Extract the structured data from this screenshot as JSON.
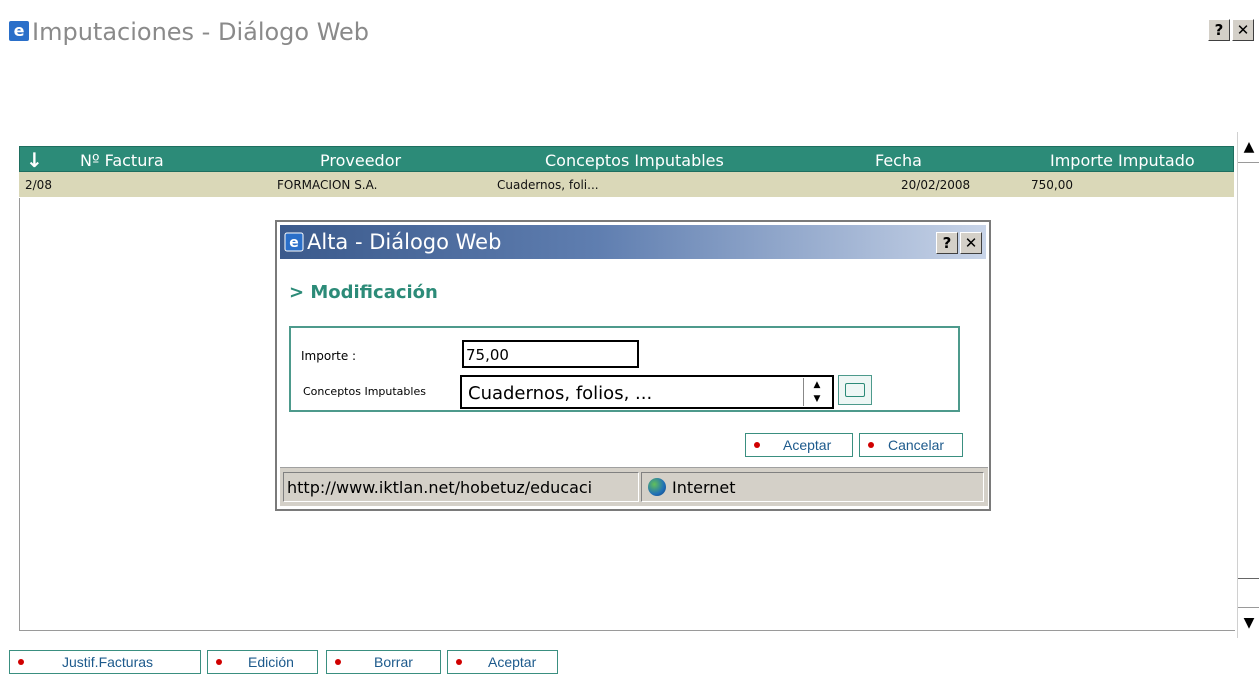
{
  "outer_window": {
    "title": "Imputaciones - Diálogo Web",
    "help_label": "?",
    "close_label": "✕"
  },
  "grid": {
    "sort_icon": "↓",
    "columns": [
      "Nº Factura",
      "Proveedor",
      "Conceptos Imputables",
      "Fecha",
      "Importe Imputado"
    ],
    "rows": [
      {
        "factura": "2/08",
        "proveedor": "FORMACION S.A.",
        "conceptos": "Cuadernos, foli...",
        "fecha": "20/02/2008",
        "importe": "750,00"
      }
    ]
  },
  "dialog": {
    "title": "Alta - Diálogo Web",
    "help_label": "?",
    "close_label": "✕",
    "heading": "> Modificación",
    "importe_label": "Importe   :",
    "importe_value": "75,00",
    "conceptos_label": "Conceptos Imputables",
    "conceptos_value": "Cuadernos, folios, ...",
    "aceptar_label": "Aceptar",
    "cancelar_label": "Cancelar",
    "status_url": "http://www.iktlan.net/hobetuz/educaci",
    "status_zone": "Internet"
  },
  "bottom_buttons": [
    "Justif.Facturas",
    "Edición",
    "Borrar",
    "Aceptar"
  ],
  "colors": {
    "accent": "#2c8b78",
    "row_bg": "#dad8b8",
    "button_text": "#1d5a8c",
    "bullet": "#d00000"
  }
}
